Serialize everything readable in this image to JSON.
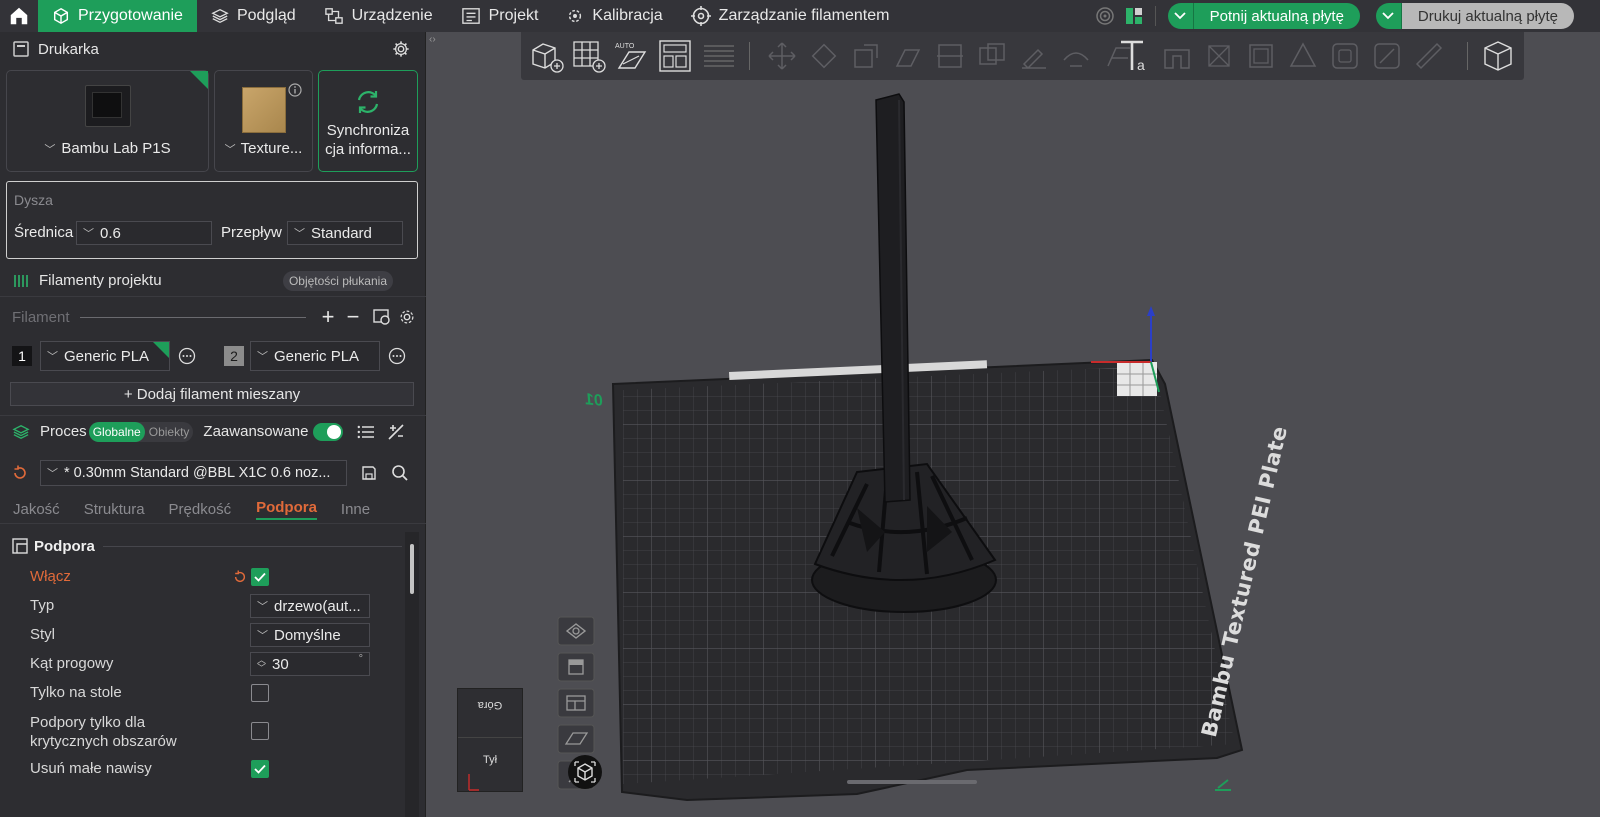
{
  "topbar": {
    "tabs": [
      {
        "label": "Przygotowanie",
        "icon": "cube-icon",
        "active": true
      },
      {
        "label": "Podgląd",
        "icon": "layers-icon"
      },
      {
        "label": "Urządzenie",
        "icon": "device-icon"
      },
      {
        "label": "Projekt",
        "icon": "project-icon"
      },
      {
        "label": "Kalibracja",
        "icon": "calibration-icon"
      },
      {
        "label": "Zarządzanie filamentem",
        "icon": "filament-target-icon"
      }
    ],
    "slice_button": "Potnij aktualną płytę",
    "print_button": "Drukuj aktualną płytę",
    "accent": "#1e9e5a"
  },
  "printer": {
    "title": "Drukarka",
    "printer_name": "Bambu Lab P1S",
    "plate_name": "Texture...",
    "sync_label": "Synchronizacja informa...",
    "sync_line1": "Synchroniza",
    "sync_line2": "cja informa..."
  },
  "nozzle": {
    "title": "Dysza",
    "diameter_label": "Średnica",
    "diameter_value": "0.6",
    "flow_label": "Przepływ",
    "flow_value": "Standard"
  },
  "filaments": {
    "title": "Filamenty projektu",
    "flush_button": "Objętości płukania",
    "subheader": "Filament",
    "items": [
      {
        "index": "1",
        "name": "Generic PLA",
        "color": "#1a1a1a"
      },
      {
        "index": "2",
        "name": "Generic PLA",
        "color": "#8c8c8c"
      }
    ],
    "add_mixed": "+ Dodaj filament mieszany"
  },
  "process": {
    "title": "Proces",
    "global_label": "Globalne",
    "objects_label": "Obiekty",
    "advanced_label": "Zaawansowane",
    "preset": "* 0.30mm Standard @BBL X1C 0.6 noz...",
    "tabs": [
      "Jakość",
      "Struktura",
      "Prędkość",
      "Podpora",
      "Inne"
    ],
    "active_tab": "Podpora"
  },
  "support": {
    "section_title": "Podpora",
    "enable_label": "Włącz",
    "enable_checked": true,
    "type_label": "Typ",
    "type_value": "drzewo(aut...",
    "style_label": "Styl",
    "style_value": "Domyślne",
    "threshold_label": "Kąt progowy",
    "threshold_value": "30",
    "threshold_unit": "°",
    "on_build_plate_label": "Tylko na stole",
    "on_build_plate_checked": false,
    "critical_line1": "Podpory tylko dla",
    "critical_line2": "krytycznych obszarów",
    "critical_checked": false,
    "remove_small_label": "Usuń małe nawisy",
    "remove_small_checked": true
  },
  "viewport": {
    "plate_text": "Bambu Textured PEI Plate",
    "plate_number": "01",
    "cube_top": "Góra",
    "cube_front": "Tył"
  }
}
